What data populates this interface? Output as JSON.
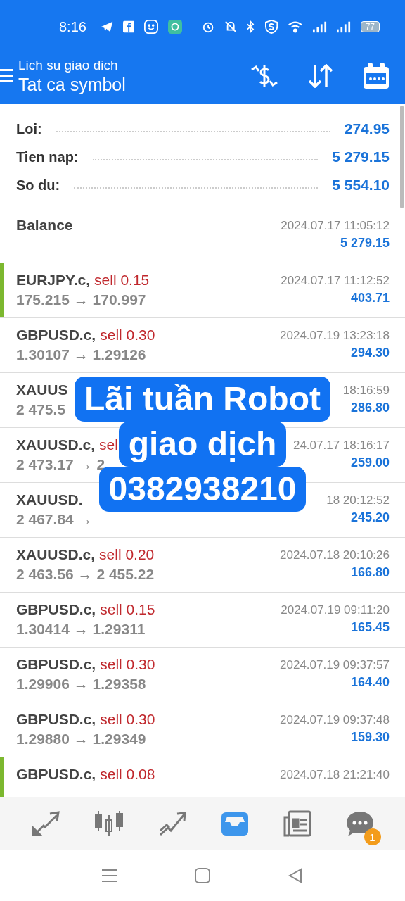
{
  "status_bar": {
    "time": "8:16",
    "battery": "77"
  },
  "header": {
    "subtitle": "Lich su giao dich",
    "title": "Tat ca symbol"
  },
  "summary": [
    {
      "label": "Loi:",
      "value": "274.95"
    },
    {
      "label": "Tien nap:",
      "value": "5 279.15"
    },
    {
      "label": "So du:",
      "value": "5 554.10"
    }
  ],
  "rows": [
    {
      "symbol": "Balance",
      "time": "2024.07.17 11:05:12",
      "profit": "5 279.15",
      "flagged": false
    },
    {
      "symbol": "EURJPY.c,",
      "trade": "sell 0.15",
      "prices": "175.215 → 170.997",
      "time": "2024.07.17 11:12:52",
      "profit": "403.71",
      "flagged": true
    },
    {
      "symbol": "GBPUSD.c,",
      "trade": "sell 0.30",
      "prices": "1.30107 → 1.29126",
      "time": "2024.07.19 13:23:18",
      "profit": "294.30",
      "flagged": false
    },
    {
      "symbol": "XAUUS",
      "prices": "2 475.5",
      "time": "18:16:59",
      "profit": "286.80",
      "flagged": false
    },
    {
      "symbol": "XAUUSD.c,",
      "trade": "sel",
      "prices": "2 473.17 → 2",
      "time": "24.07.17 18:16:17",
      "profit": "259.00",
      "flagged": false
    },
    {
      "symbol": "XAUUSD.",
      "prices": "2 467.84 →",
      "time": "18 20:12:52",
      "profit": "245.20",
      "flagged": false
    },
    {
      "symbol": "XAUUSD.c,",
      "trade": "sell 0.20",
      "prices": "2 463.56 → 2 455.22",
      "time": "2024.07.18 20:10:26",
      "profit": "166.80",
      "flagged": false
    },
    {
      "symbol": "GBPUSD.c,",
      "trade": "sell 0.15",
      "prices": "1.30414 → 1.29311",
      "time": "2024.07.19 09:11:20",
      "profit": "165.45",
      "flagged": false
    },
    {
      "symbol": "GBPUSD.c,",
      "trade": "sell 0.30",
      "prices": "1.29906 → 1.29358",
      "time": "2024.07.19 09:37:57",
      "profit": "164.40",
      "flagged": false
    },
    {
      "symbol": "GBPUSD.c,",
      "trade": "sell 0.30",
      "prices": "1.29880 → 1.29349",
      "time": "2024.07.19 09:37:48",
      "profit": "159.30",
      "flagged": false
    },
    {
      "symbol": "GBPUSD.c,",
      "trade": "sell 0.08",
      "time": "2024.07.18 21:21:40",
      "flagged": true
    }
  ],
  "overlay": {
    "lines": [
      "Lãi tuần Robot",
      "giao dịch",
      "0382938210"
    ]
  },
  "bottom_nav": [
    {
      "kind": "trade",
      "selected": false
    },
    {
      "kind": "quotes",
      "selected": false
    },
    {
      "kind": "chart",
      "selected": false
    },
    {
      "kind": "history",
      "selected": true
    },
    {
      "kind": "news",
      "selected": false
    },
    {
      "kind": "chat",
      "selected": false,
      "badge": "1"
    }
  ]
}
